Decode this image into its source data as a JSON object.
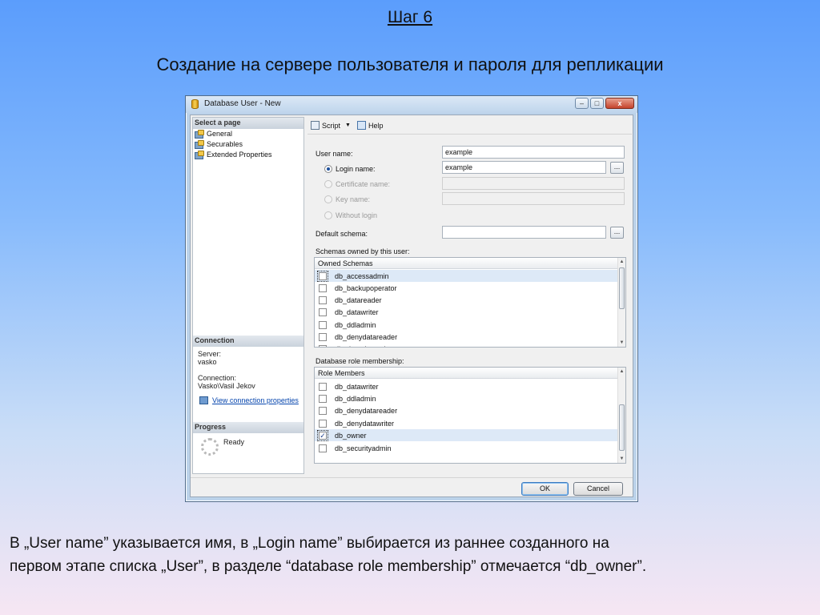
{
  "slide": {
    "step": "Шаг 6",
    "title": "Создание на сервере пользователя и пароля для репликации",
    "caption_line1": "В „User name” указывается имя, в „Login name” выбирается из раннее созданного  на",
    "caption_line2": "первом этапе списка „User”, в разделе “database role membership” отмечается  “db_owner”."
  },
  "window": {
    "title": "Database User - New",
    "controls": {
      "minimize": "–",
      "maximize": "□",
      "close": "x"
    }
  },
  "left_pane": {
    "select_page_header": "Select a page",
    "pages": [
      "General",
      "Securables",
      "Extended Properties"
    ],
    "connection_header": "Connection",
    "server_label": "Server:",
    "server_value": "vasko",
    "connection_label": "Connection:",
    "connection_value": "Vasko\\Vasil Jekov",
    "view_connection_link": "View connection properties",
    "progress_header": "Progress",
    "progress_status": "Ready"
  },
  "toolbar": {
    "script_label": "Script",
    "help_label": "Help"
  },
  "form": {
    "user_name_label": "User name:",
    "user_name_value": "example",
    "login_name_label": "Login name:",
    "login_name_value": "example",
    "certificate_name_label": "Certificate name:",
    "key_name_label": "Key name:",
    "without_login_label": "Without login",
    "default_schema_label": "Default schema:",
    "browse_label": "..."
  },
  "schemas": {
    "section_label": "Schemas owned by this user:",
    "column_header": "Owned Schemas",
    "items": [
      "db_accessadmin",
      "db_backupoperator",
      "db_datareader",
      "db_datawriter",
      "db_ddladmin",
      "db_denydatareader",
      "db_denydatawriter"
    ]
  },
  "roles": {
    "section_label": "Database role membership:",
    "column_header": "Role Members",
    "items": [
      "db_datawriter",
      "db_ddladmin",
      "db_denydatareader",
      "db_denydatawriter",
      "db_owner",
      "db_securityadmin"
    ],
    "checked": "db_owner"
  },
  "buttons": {
    "ok": "OK",
    "cancel": "Cancel"
  }
}
